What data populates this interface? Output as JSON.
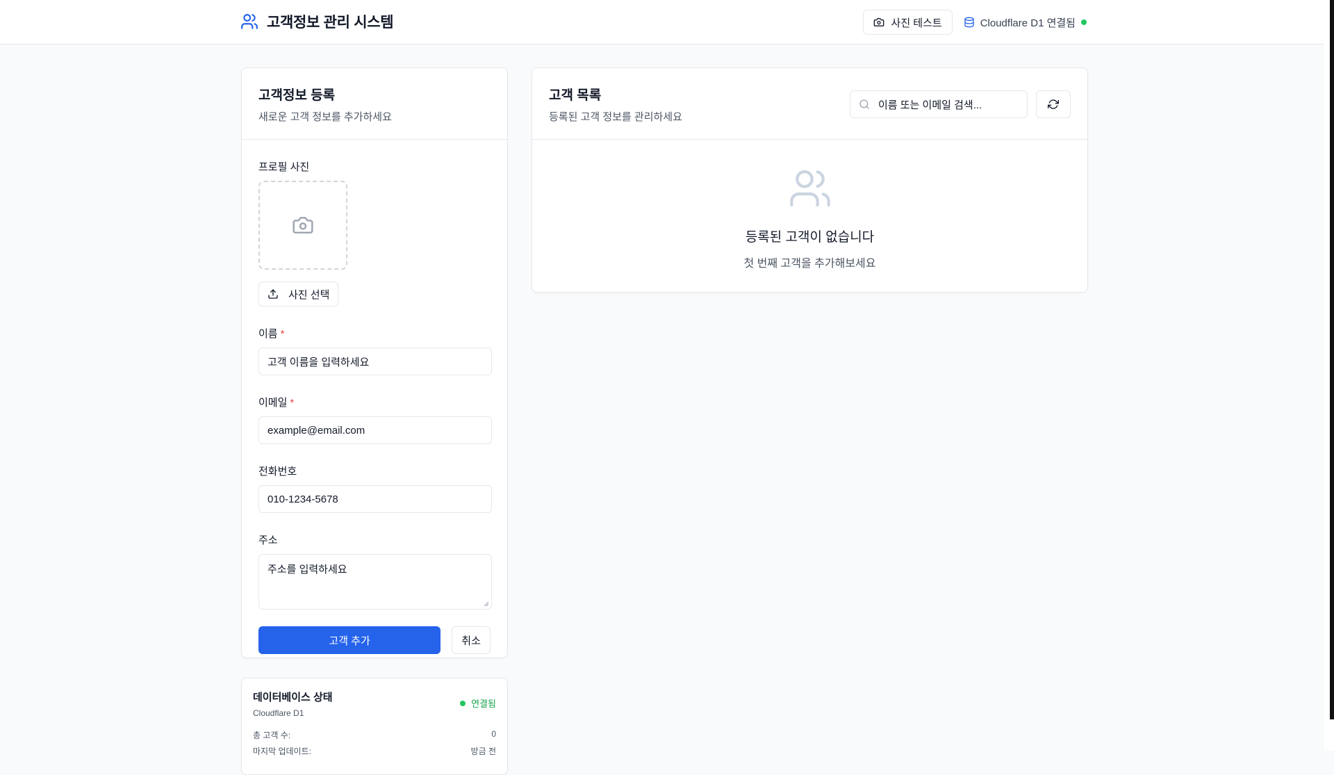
{
  "header": {
    "title": "고객정보 관리 시스템",
    "photo_test_label": "사진 테스트",
    "db_status_label": "Cloudflare D1 연결됨"
  },
  "form": {
    "title": "고객정보 등록",
    "description": "새로운 고객 정보를 추가하세요",
    "photo_label": "프로필 사진",
    "photo_button": "사진 선택",
    "name_label": "이름",
    "name_placeholder": "고객 이름을 입력하세요",
    "email_label": "이메일",
    "email_placeholder": "example@email.com",
    "phone_label": "전화번호",
    "phone_placeholder": "010-1234-5678",
    "address_label": "주소",
    "address_placeholder": "주소를 입력하세요",
    "required_mark": "*",
    "submit_label": "고객 추가",
    "cancel_label": "취소"
  },
  "db_card": {
    "title": "데이터베이스 상태",
    "subtitle": "Cloudflare D1",
    "badge": "연결됨",
    "total_label": "총 고객 수:",
    "total_value": "0",
    "updated_label": "마지막 업데이트:",
    "updated_value": "방금 전"
  },
  "list": {
    "title": "고객 목록",
    "description": "등록된 고객 정보를 관리하세요",
    "search_placeholder": "이름 또는 이메일 검색...",
    "empty_title": "등록된 고객이 없습니다",
    "empty_subtitle": "첫 번째 고객을 추가해보세요"
  },
  "colors": {
    "primary": "#2563eb",
    "success": "#22c55e",
    "required": "#ef4444"
  }
}
